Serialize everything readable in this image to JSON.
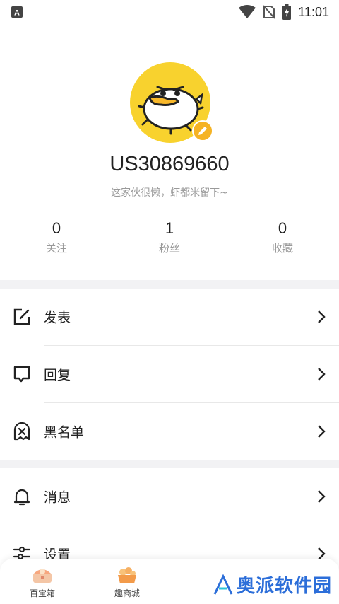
{
  "status_bar": {
    "time": "11:01",
    "icons": [
      "notification-a-icon",
      "wifi-icon",
      "no-sim-icon",
      "battery-charging-icon"
    ]
  },
  "profile": {
    "username": "US30869660",
    "bio": "这家伙很懒，虾都米留下~",
    "avatar_bg": "#f8d22e",
    "edit_badge_color": "#f5b324",
    "stats": [
      {
        "value": "0",
        "label": "关注"
      },
      {
        "value": "1",
        "label": "粉丝"
      },
      {
        "value": "0",
        "label": "收藏"
      }
    ]
  },
  "menu": {
    "group1": [
      {
        "label": "发表",
        "icon": "edit-square-icon"
      },
      {
        "label": "回复",
        "icon": "reply-bubble-icon"
      },
      {
        "label": "黑名单",
        "icon": "blacklist-ghost-icon"
      }
    ],
    "group2": [
      {
        "label": "消息",
        "icon": "bell-icon"
      },
      {
        "label": "设置",
        "icon": "settings-sliders-icon"
      }
    ]
  },
  "bottom_nav": {
    "items": [
      {
        "label": "百宝箱",
        "icon": "treasure-chest-icon"
      },
      {
        "label": "趣商城",
        "icon": "mall-basket-icon"
      }
    ]
  },
  "watermark": {
    "text": "奥派软件园",
    "color": "#2c6ed9"
  }
}
